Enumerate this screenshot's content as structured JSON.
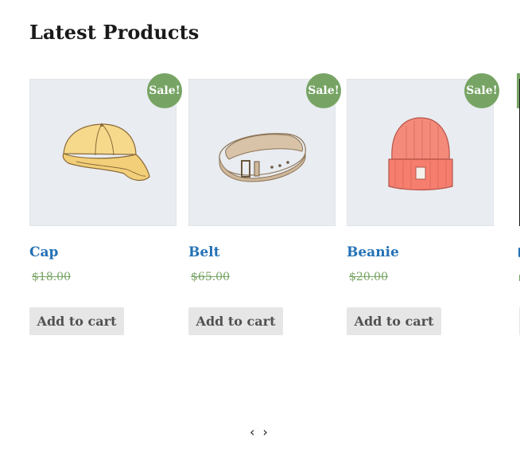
{
  "section": {
    "title": "Latest Products"
  },
  "products": [
    {
      "name": "Cap",
      "price": "$18.00",
      "badge": "Sale!",
      "button": "Add to cart",
      "image_icon": "cap-icon"
    },
    {
      "name": "Belt",
      "price": "$65.00",
      "badge": "Sale!",
      "button": "Add to cart",
      "image_icon": "belt-icon"
    },
    {
      "name": "Beanie",
      "price": "$20.00",
      "badge": "Sale!",
      "button": "Add to cart",
      "image_icon": "beanie-icon"
    }
  ],
  "carousel": {
    "prev": "‹",
    "next": "›"
  },
  "colors": {
    "sale_badge": "#77a464",
    "product_link": "#2471b5",
    "button_bg": "#e6e6e6",
    "thumb_bg": "#e9ecf0"
  }
}
